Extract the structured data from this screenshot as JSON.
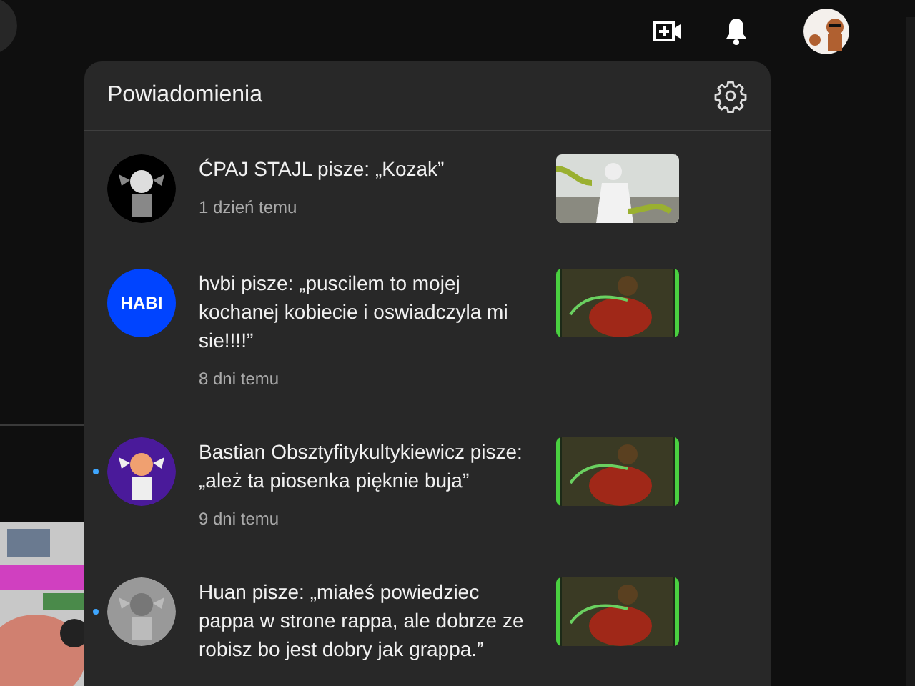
{
  "notifications": {
    "title": "Powiadomienia",
    "items": [
      {
        "text": "ĆPAJ STAJL pisze: „Kozak”",
        "time": "1 dzień temu",
        "unread": false
      },
      {
        "text": "hvbi pisze: „puscilem to mojej kochanej kobiecie i oswiadczyla mi sie!!!!”",
        "time": "8 dni temu",
        "unread": false,
        "avatar": {
          "kind": "label",
          "label": "HABI",
          "color": "#0044ff"
        }
      },
      {
        "text": "Bastian Obsztyfitykultykiewicz pisze: „ależ ta piosenka pięknie buja”",
        "time": "9 dni temu",
        "unread": true
      },
      {
        "text": "Huan pisze: „miałeś powiedziec pappa w strone rappa, ale dobrze ze robisz bo jest dobry jak grappa.”",
        "unread": true
      }
    ]
  }
}
